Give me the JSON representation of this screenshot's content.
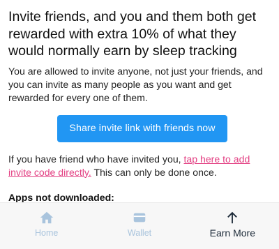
{
  "main": {
    "headline": "Invite friends, and you and them both get rewarded with extra 10% of what they would normally earn by sleep tracking",
    "description": "You are allowed to invite anyone, not just your friends, and you can invite as many people as you want and get rewarded for every one of them.",
    "share_button_label": "Share invite link with friends now",
    "invite_prefix": "If you have friend who have invited you, ",
    "invite_link_text": "tap here to add invite code directly.",
    "invite_suffix": " This can only be done once.",
    "apps_section_title": "Apps not downloaded:"
  },
  "bottom_nav": {
    "items": [
      {
        "label": "Home",
        "icon": "home-icon",
        "active": false
      },
      {
        "label": "Wallet",
        "icon": "wallet-icon",
        "active": false
      },
      {
        "label": "Earn More",
        "icon": "arrow-up-icon",
        "active": true
      }
    ]
  },
  "colors": {
    "primary_button": "#2196f3",
    "link": "#e33f82",
    "nav_inactive": "#a9c4dd",
    "nav_active": "#1c2a38",
    "nav_background": "#f7f7f7"
  }
}
